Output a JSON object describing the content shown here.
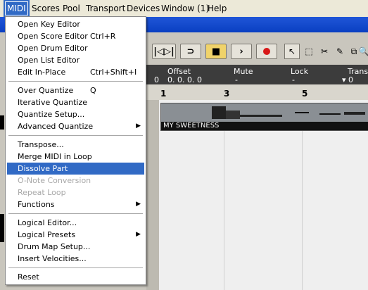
{
  "menubar": {
    "items": [
      "MIDI",
      "Scores",
      "Pool",
      "Transport",
      "Devices",
      "Window (1)",
      "Help"
    ]
  },
  "midi_menu": {
    "items": [
      {
        "label": "Open Key Editor",
        "shortcut": ""
      },
      {
        "label": "Open Score Editor",
        "shortcut": "Ctrl+R"
      },
      {
        "label": "Open Drum Editor",
        "shortcut": ""
      },
      {
        "label": "Open List Editor",
        "shortcut": ""
      },
      {
        "label": "Edit In-Place",
        "shortcut": "Ctrl+Shift+I"
      },
      {
        "label": "Over Quantize",
        "shortcut": "Q"
      },
      {
        "label": "Iterative Quantize",
        "shortcut": ""
      },
      {
        "label": "Quantize Setup...",
        "shortcut": ""
      },
      {
        "label": "Advanced Quantize",
        "shortcut": ""
      },
      {
        "label": "Transpose...",
        "shortcut": ""
      },
      {
        "label": "Merge MIDI in Loop",
        "shortcut": ""
      },
      {
        "label": "Dissolve Part",
        "shortcut": ""
      },
      {
        "label": "O-Note Conversion",
        "shortcut": ""
      },
      {
        "label": "Repeat Loop",
        "shortcut": ""
      },
      {
        "label": "Functions",
        "shortcut": ""
      },
      {
        "label": "Logical Editor...",
        "shortcut": ""
      },
      {
        "label": "Logical Presets",
        "shortcut": ""
      },
      {
        "label": "Drum Map Setup...",
        "shortcut": ""
      },
      {
        "label": "Insert Velocities...",
        "shortcut": ""
      },
      {
        "label": "Reset",
        "shortcut": ""
      }
    ]
  },
  "infoline": {
    "headers": [
      "Offset",
      "Mute",
      "Lock",
      "Trans"
    ],
    "values": [
      "0",
      "0. 0. 0. 0",
      "-",
      "-",
      "▾ 0"
    ]
  },
  "ruler": {
    "labels": [
      "1",
      "3",
      "5"
    ]
  },
  "part": {
    "name": "MY SWEETNESS"
  },
  "colors": {
    "menu_highlight": "#316ac5",
    "title_blue": "#0a3fc2",
    "record_red": "#d81818"
  }
}
